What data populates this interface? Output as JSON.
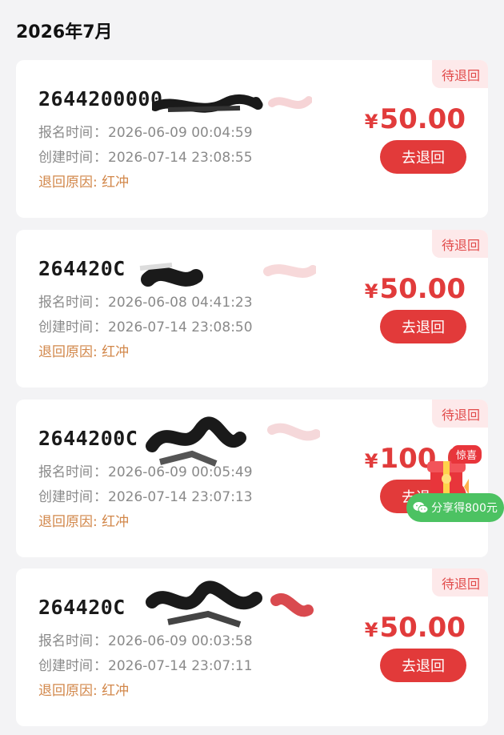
{
  "page": {
    "month_title": "2026年7月"
  },
  "labels": {
    "signup_label": "报名时间",
    "create_label": "创建时间",
    "reason_label": "退回原因",
    "colon_cn": "：",
    "colon_en": ": "
  },
  "cards": [
    {
      "badge": "待退回",
      "order_no": "2644200000",
      "signup_time": "2026-06-09 00:04:59",
      "create_time": "2026-07-14 23:08:55",
      "reason": "红冲",
      "currency": "¥",
      "amount": "50.00",
      "button": "去退回"
    },
    {
      "badge": "待退回",
      "order_no": "264420C",
      "signup_time": "2026-06-08 04:41:23",
      "create_time": "2026-07-14 23:08:50",
      "reason": "红冲",
      "currency": "¥",
      "amount": "50.00",
      "button": "去退回"
    },
    {
      "badge": "待退回",
      "order_no": "2644200C",
      "signup_time": "2026-06-09 00:05:49",
      "create_time": "2026-07-14 23:07:13",
      "reason": "红冲",
      "currency": "¥",
      "amount": "100.0",
      "button": "去退回"
    },
    {
      "badge": "待退回",
      "order_no": "264420C",
      "signup_time": "2026-06-09 00:03:58",
      "create_time": "2026-07-14 23:07:11",
      "reason": "红冲",
      "currency": "¥",
      "amount": "50.00",
      "button": "去退回"
    }
  ],
  "floating_promo": {
    "surprise_tag": "惊喜",
    "share_text": "分享得800元",
    "icon": "wechat-icon",
    "colors": {
      "pill": "#4cc262",
      "tag": "#e8353b"
    }
  },
  "colors": {
    "accent": "#e23a3a",
    "reason": "#d2874a",
    "muted": "#8a8a8a"
  }
}
